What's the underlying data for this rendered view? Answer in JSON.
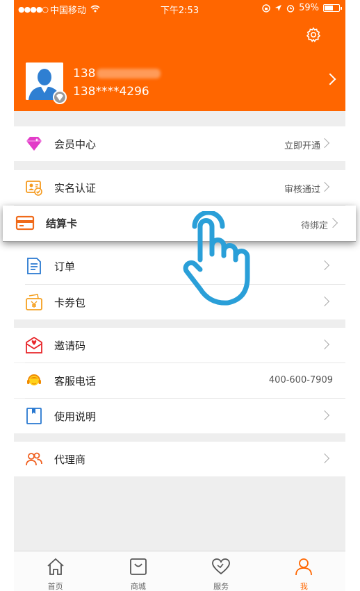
{
  "status_bar": {
    "signal_dots": "●●●●○",
    "carrier": "中国移动",
    "time": "下午2:53",
    "battery": "59%",
    "battery_level": 0.59
  },
  "profile": {
    "phone_masked_prefix": "138",
    "phone": "138****4296"
  },
  "menu": {
    "vip": {
      "label": "会员中心",
      "value": "立即开通"
    },
    "realname": {
      "label": "实名认证",
      "value": "审核通过"
    },
    "card": {
      "label": "结算卡",
      "value": "待绑定"
    },
    "orders": {
      "label": "订单"
    },
    "coupons": {
      "label": "卡券包"
    },
    "invite": {
      "label": "邀请码"
    },
    "service": {
      "label": "客服电话",
      "value": "400-600-7909"
    },
    "manual": {
      "label": "使用说明"
    },
    "agent": {
      "label": "代理商"
    }
  },
  "tabs": [
    {
      "label": "首页",
      "icon": "home-icon"
    },
    {
      "label": "商城",
      "icon": "shop-bag-icon"
    },
    {
      "label": "服务",
      "icon": "heart-icon"
    },
    {
      "label": "我",
      "icon": "user-icon",
      "active": true
    }
  ],
  "colors": {
    "brand": "#ff6600",
    "hand": "#2a9fd8"
  }
}
